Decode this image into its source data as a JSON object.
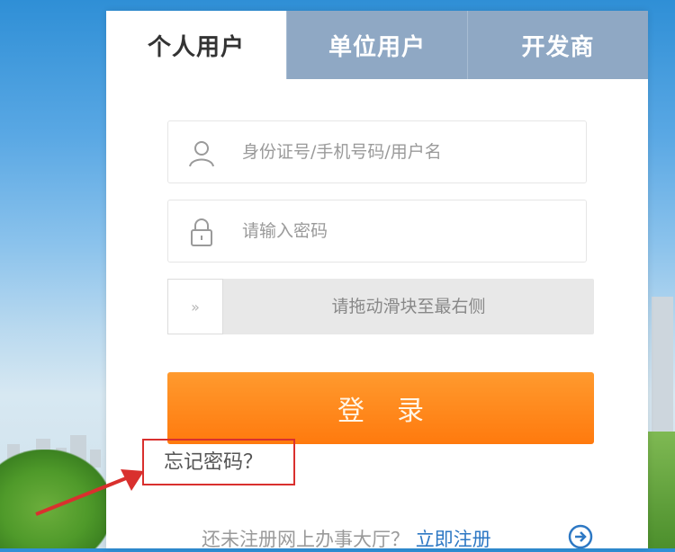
{
  "tabs": [
    {
      "label": "个人用户",
      "active": true
    },
    {
      "label": "单位用户",
      "active": false
    },
    {
      "label": "开发商",
      "active": false
    }
  ],
  "form": {
    "username_placeholder": "身份证号/手机号码/用户名",
    "password_placeholder": "请输入密码",
    "slider_handle_glyph": "»",
    "slider_text": "请拖动滑块至最右侧",
    "login_label": "登录"
  },
  "forgot_password": "忘记密码？",
  "register": {
    "prompt": "还未注册网上办事大厅？",
    "link": "立即注册"
  },
  "colors": {
    "tab_inactive": "#8fa8c4",
    "login_button": "#ff8418",
    "highlight_box": "#d9302e",
    "link": "#2d78c4"
  },
  "icons": [
    "user-icon",
    "lock-icon",
    "double-chevron-right-icon",
    "arrow-right-circle-icon"
  ]
}
